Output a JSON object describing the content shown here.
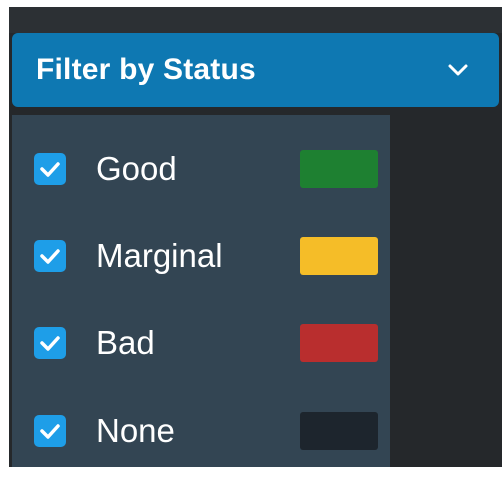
{
  "dropdown": {
    "label": "Filter by Status",
    "icon": "chevron-down-icon",
    "color": "#0e78b2"
  },
  "statuses": [
    {
      "label": "Good",
      "checked": true,
      "color": "#1e8031"
    },
    {
      "label": "Marginal",
      "checked": true,
      "color": "#f5bd28"
    },
    {
      "label": "Bad",
      "checked": true,
      "color": "#b92e2e"
    },
    {
      "label": "None",
      "checked": true,
      "color": "#1d252d"
    }
  ],
  "colors": {
    "panel": "#334553",
    "checkbox": "#1e9ee8",
    "background": "#25282b"
  }
}
